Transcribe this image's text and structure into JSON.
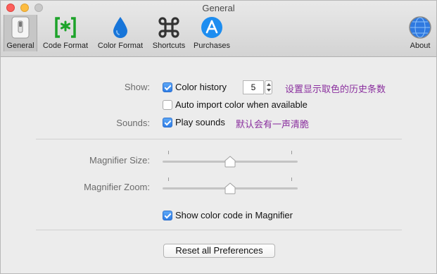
{
  "window": {
    "title": "General"
  },
  "toolbar": {
    "items": [
      {
        "label": "General",
        "icon": "general-switch-icon"
      },
      {
        "label": "Code Format",
        "icon": "code-brackets-icon"
      },
      {
        "label": "Color Format",
        "icon": "drop-icon"
      },
      {
        "label": "Shortcuts",
        "icon": "command-icon"
      },
      {
        "label": "Purchases",
        "icon": "app-store-icon"
      },
      {
        "label": "About",
        "icon": "globe-icon"
      }
    ],
    "active": "General"
  },
  "show": {
    "label": "Show:",
    "color_history_label": "Color history",
    "color_history_checked": true,
    "history_count": "5",
    "history_note": "设置显示取色的历史条数",
    "auto_import_label": "Auto import color when available",
    "auto_import_checked": false
  },
  "sounds": {
    "label": "Sounds:",
    "play_sounds_label": "Play sounds",
    "play_sounds_checked": true,
    "note": "默认会有一声清脆"
  },
  "magnifier": {
    "size_label": "Magnifier Size:",
    "size_value": 0.5,
    "zoom_label": "Magnifier Zoom:",
    "zoom_value": 0.5,
    "show_code_label": "Show color code in Magnifier",
    "show_code_checked": true
  },
  "reset_button": "Reset all Preferences",
  "colors": {
    "accent": "#2f7de6",
    "note_text": "#8a2f9e"
  }
}
